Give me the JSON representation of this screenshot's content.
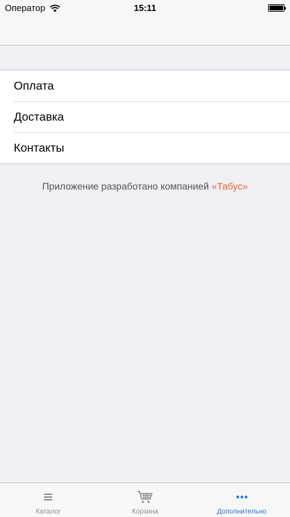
{
  "status_bar": {
    "carrier": "Оператор",
    "time": "15:11"
  },
  "menu": {
    "items": [
      {
        "label": "Оплата"
      },
      {
        "label": "Доставка"
      },
      {
        "label": "Контакты"
      }
    ]
  },
  "footer": {
    "text": "Приложение разработано компанией",
    "brand": "«Табус»",
    "brand_color": "#e8672e"
  },
  "tabbar": {
    "tabs": [
      {
        "label": "Каталог",
        "icon": "list-icon",
        "active": false
      },
      {
        "label": "Корзина",
        "icon": "cart-icon",
        "active": false
      },
      {
        "label": "Дополнительно",
        "icon": "more-icon",
        "active": true
      }
    ],
    "active_color": "#2679d4",
    "inactive_color": "#8e8e93"
  }
}
